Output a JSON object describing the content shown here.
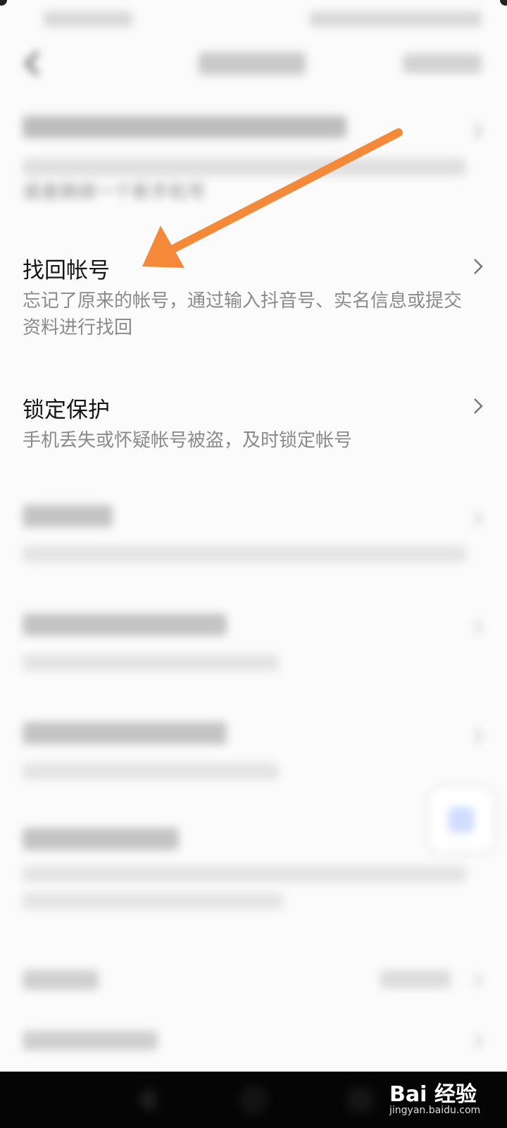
{
  "status_bar": {
    "left": "",
    "right": ""
  },
  "header": {
    "title": "",
    "action": ""
  },
  "items": [
    {
      "title": "",
      "desc": "或者换绑一个新手机号"
    },
    {
      "title": "找回帐号",
      "desc": "忘记了原来的帐号，通过输入抖音号、实名信息或提交资料进行找回"
    },
    {
      "title": "锁定保护",
      "desc": "手机丢失或怀疑帐号被盗，及时锁定帐号"
    },
    {
      "title": "",
      "desc": ""
    },
    {
      "title": "",
      "desc": ""
    },
    {
      "title": "",
      "desc": ""
    },
    {
      "title": "",
      "desc": ""
    }
  ],
  "bottom_rows": [
    {
      "title": "",
      "value": ""
    },
    {
      "title": ""
    }
  ],
  "watermark": {
    "main": "Bai 经验",
    "sub": "jingyan.baidu.com"
  },
  "colors": {
    "arrow": "#f5893a",
    "text_primary": "#161616",
    "text_secondary": "#8a8a8a"
  },
  "icons": [
    "back-icon",
    "chevron-right-icon",
    "nav-back-icon",
    "nav-home-icon",
    "nav-recent-icon"
  ]
}
